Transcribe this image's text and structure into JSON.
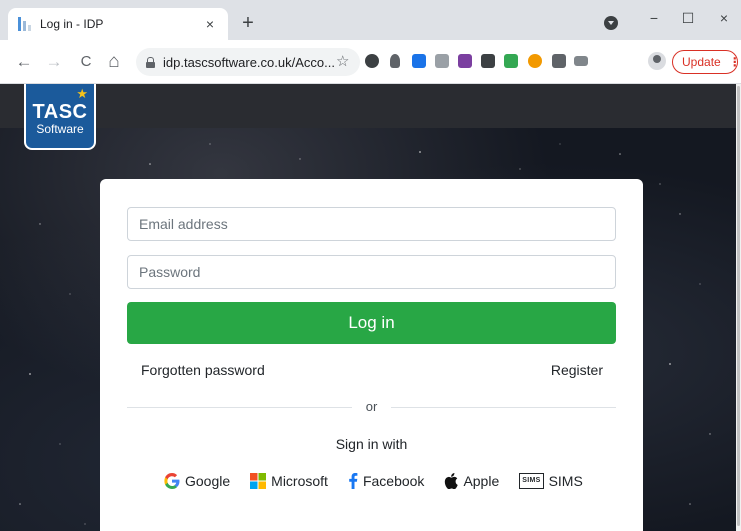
{
  "browser": {
    "tab_title": "Log in - IDP",
    "tab_close": "×",
    "new_tab": "+",
    "url": "idp.tascsoftware.co.uk/Acco...",
    "update_label": "Update",
    "update_menu": "⋮",
    "back": "←",
    "forward": "→",
    "reload": "C",
    "home": "⌂",
    "bookmark_star": "☆",
    "minimize": "−",
    "maximize": "☐",
    "close": "×"
  },
  "logo": {
    "main": "TASC",
    "sub": "Software"
  },
  "form": {
    "email_placeholder": "Email address",
    "password_placeholder": "Password",
    "login_label": "Log in",
    "forgot_label": "Forgotten password",
    "register_label": "Register",
    "or_label": "or",
    "sign_in_with": "Sign in with"
  },
  "providers": [
    {
      "name": "Google",
      "icon": "google-icon"
    },
    {
      "name": "Microsoft",
      "icon": "microsoft-icon"
    },
    {
      "name": "Facebook",
      "icon": "facebook-icon"
    },
    {
      "name": "Apple",
      "icon": "apple-icon"
    },
    {
      "name": "SIMS",
      "icon": "sims-icon",
      "icon_text": "SIMS"
    }
  ],
  "colors": {
    "login_button": "#28a745",
    "logo_bg": "#1b5a9b",
    "update_red": "#d93025"
  }
}
